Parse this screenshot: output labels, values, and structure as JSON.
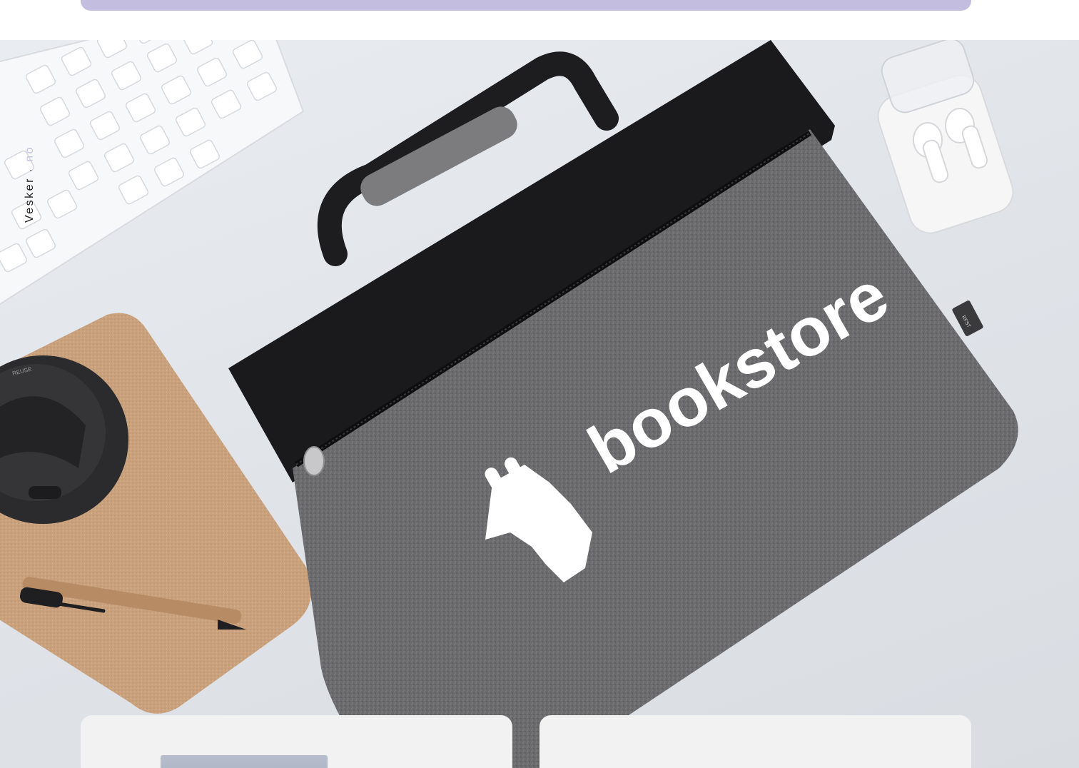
{
  "banner": {
    "color": "#c3bddf"
  },
  "hero": {
    "side_label": {
      "brand": "Vesker",
      "separator": "·",
      "sub": "no"
    },
    "bag_logo_text": "bookstore",
    "bag_tag_text": "RFST",
    "cup_text": "REUSE"
  },
  "cards": [
    {
      "id": "card-left"
    },
    {
      "id": "card-right"
    }
  ]
}
